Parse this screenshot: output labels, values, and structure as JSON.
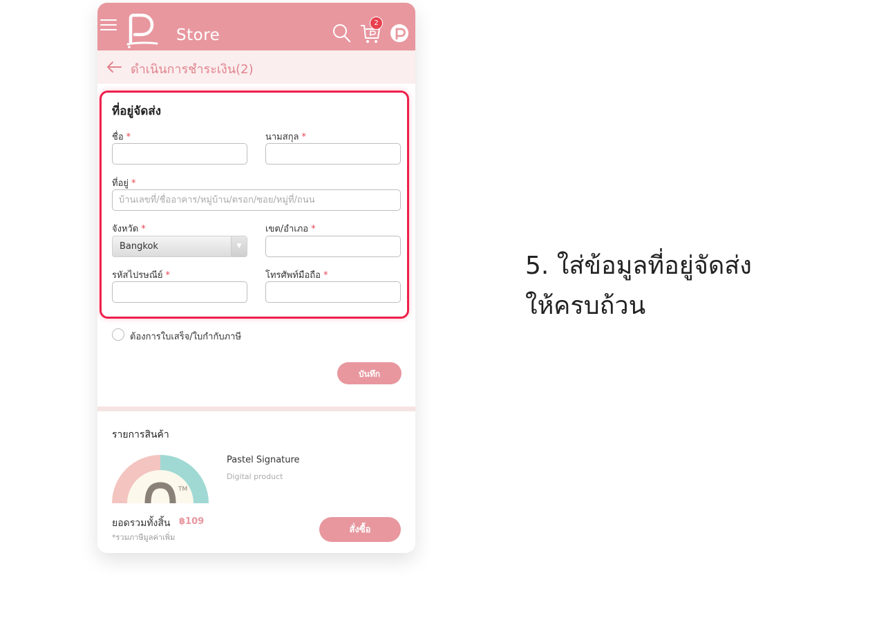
{
  "header": {
    "store_label": "Store",
    "cart_count": "2",
    "colors": {
      "brand": "#e8979f",
      "badge": "#e8414f",
      "highlight": "#ee1f4b"
    },
    "icons": [
      "menu-icon",
      "pastel-logo",
      "search-icon",
      "cart-icon",
      "profile-icon"
    ]
  },
  "subheader": {
    "title": "ดำเนินการชำระเงิน(2)"
  },
  "address": {
    "section_title": "ที่อยู่จัดส่ง",
    "required_mark": "*",
    "first_name": {
      "label": "ชื่อ",
      "value": ""
    },
    "last_name": {
      "label": "นามสกุล",
      "value": ""
    },
    "address": {
      "label": "ที่อยู่",
      "placeholder": "บ้านเลขที่/ชื่ออาคาร/หมู่บ้าน/ตรอก/ซอย/หมู่ที่/ถนน"
    },
    "province": {
      "label": "จังหวัด",
      "selected": "Bangkok"
    },
    "district": {
      "label": "เขต/อำเภอ",
      "value": ""
    },
    "postcode": {
      "label": "รหัสไปรษณีย์",
      "value": ""
    },
    "phone": {
      "label": "โทรศัพท์มือถือ",
      "value": ""
    }
  },
  "invoice_option": {
    "label": "ต้องการใบเสร็จ/ใบกำกับภาษี",
    "checked": false
  },
  "save_button": "บันทึก",
  "items": {
    "title": "รายการสินค้า",
    "product": {
      "name": "Pastel Signature",
      "type": "Digital product",
      "thumb_mark": "TM"
    }
  },
  "summary": {
    "total_label": "ยอดรวมทั้งสิ้น",
    "total_value": "฿109",
    "vat_note": "*รวมภาษีมูลค่าเพิ่ม",
    "order_button": "สั่งซื้อ"
  },
  "instruction": {
    "line1": "5. ใส่ข้อมูลที่อยู่จัดส่ง",
    "line2": "ให้ครบถ้วน"
  }
}
